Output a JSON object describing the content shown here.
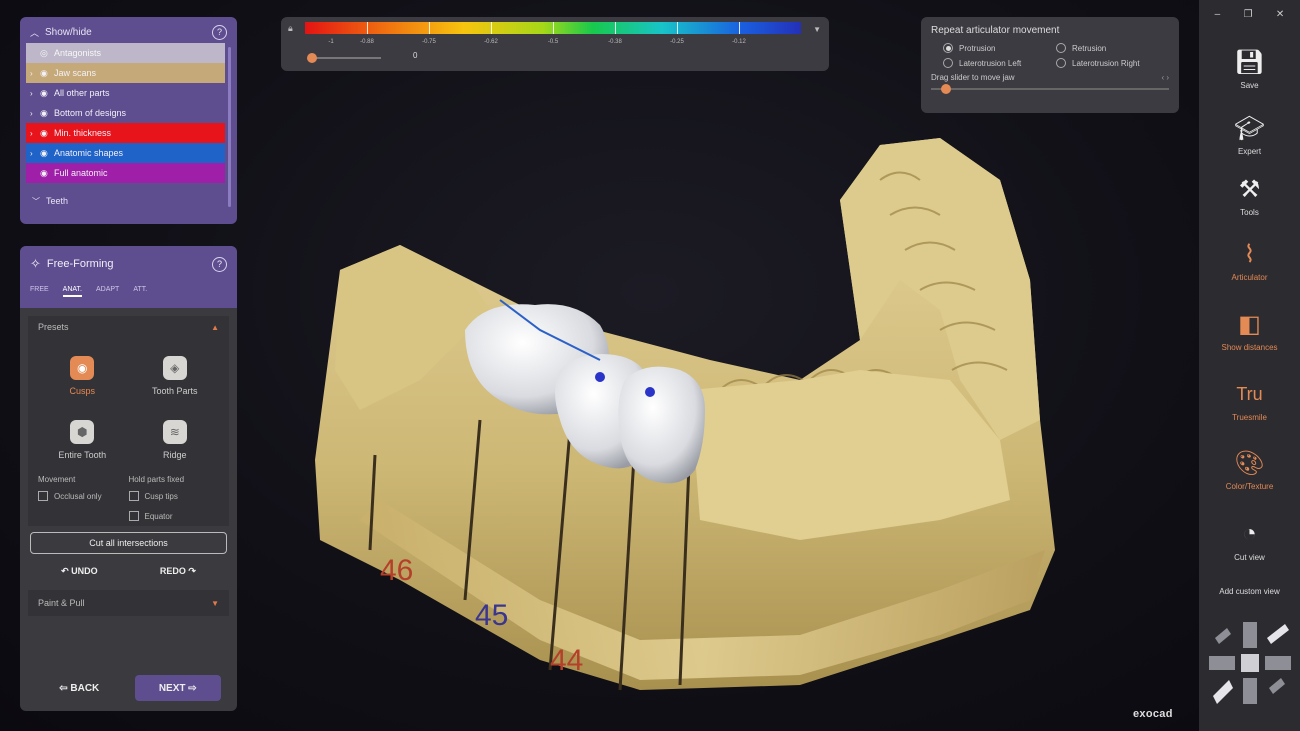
{
  "showhide": {
    "title": "Show/hide",
    "items": [
      {
        "label": "Antagonists",
        "color": "#bdb7c9",
        "expandable": false
      },
      {
        "label": "Jaw scans",
        "color": "#c6a978",
        "expandable": true
      },
      {
        "label": "All other parts",
        "color": "#5e4e8f",
        "expandable": true
      },
      {
        "label": "Bottom of designs",
        "color": "#5e4e8f",
        "expandable": true
      },
      {
        "label": "Min. thickness",
        "color": "#e8141c",
        "expandable": true
      },
      {
        "label": "Anatomic shapes",
        "color": "#1f62c8",
        "expandable": true
      },
      {
        "label": "Full anatomic",
        "color": "#a01fa8",
        "expandable": false
      }
    ],
    "teeth_label": "Teeth"
  },
  "freeform": {
    "title": "Free-Forming",
    "tabs": [
      "FREE",
      "ANAT.",
      "ADAPT",
      "ATT."
    ],
    "active_tab": "ANAT.",
    "presets_label": "Presets",
    "presets": [
      "Cusps",
      "Tooth Parts",
      "Entire Tooth",
      "Ridge"
    ],
    "selected_preset": "Cusps",
    "movement_label": "Movement",
    "hold_label": "Hold parts fixed",
    "occlusal_only": "Occlusal only",
    "cusp_tips": "Cusp tips",
    "equator": "Equator",
    "cut_button": "Cut all intersections",
    "undo": "UNDO",
    "redo": "REDO",
    "paint_label": "Paint & Pull",
    "back": "BACK",
    "next": "NEXT"
  },
  "scale": {
    "labels": [
      "-1",
      "-0.88",
      "-0.75",
      "-0.62",
      "-0.5",
      "-0.38",
      "-0.25",
      "-0.12"
    ],
    "slider_value": "0"
  },
  "articulator": {
    "title": "Repeat articulator movement",
    "options": [
      "Protrusion",
      "Retrusion",
      "Laterotrusion Left",
      "Laterotrusion Right"
    ],
    "selected": "Protrusion",
    "drag_label": "Drag slider to move jaw"
  },
  "toolbar": {
    "items": [
      {
        "label": "Save",
        "icon": "save-icon",
        "highlight": false
      },
      {
        "label": "Expert",
        "icon": "graduation-cap-icon",
        "highlight": false
      },
      {
        "label": "Tools",
        "icon": "tools-icon",
        "highlight": false
      },
      {
        "label": "Articulator",
        "icon": "articulator-icon",
        "highlight": true
      },
      {
        "label": "Show distances",
        "icon": "distances-icon",
        "highlight": true
      },
      {
        "label": "Truesmile",
        "icon": "truesmile-icon",
        "highlight": true
      },
      {
        "label": "Color/Texture",
        "icon": "palette-icon",
        "highlight": true
      },
      {
        "label": "Cut view",
        "icon": "cut-view-icon",
        "highlight": false
      }
    ],
    "add_view": "Add custom view"
  },
  "viewport": {
    "tooth_numbers": [
      {
        "label": "46",
        "color": "#b5402a"
      },
      {
        "label": "45",
        "color": "#3a3590"
      },
      {
        "label": "44",
        "color": "#b5402a"
      }
    ]
  },
  "brand": "exocad",
  "colors": {
    "accent": "#e48a55",
    "panel_purple": "#5e4e8f"
  }
}
